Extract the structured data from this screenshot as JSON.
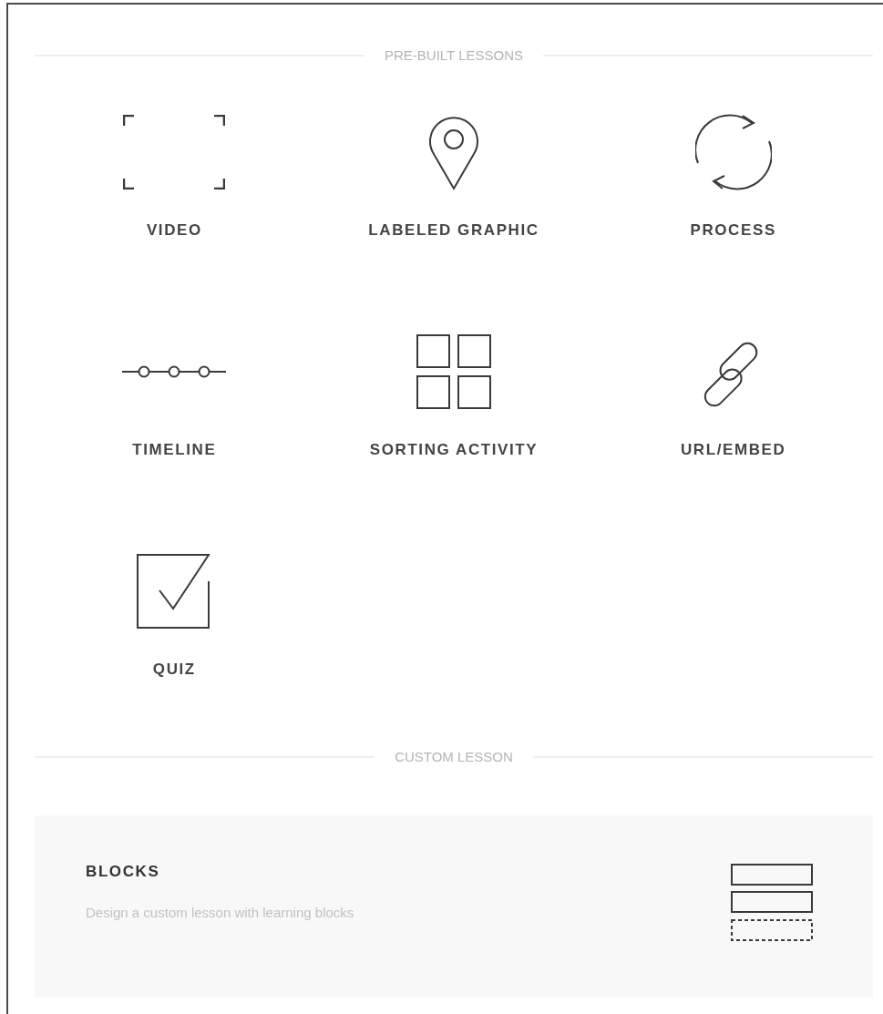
{
  "prebuilt_heading": "PRE-BUILT LESSONS",
  "lessons": [
    {
      "kind": "video",
      "label": "VIDEO"
    },
    {
      "kind": "pin",
      "label": "LABELED GRAPHIC"
    },
    {
      "kind": "process",
      "label": "PROCESS"
    },
    {
      "kind": "timeline",
      "label": "TIMELINE"
    },
    {
      "kind": "grid",
      "label": "SORTING ACTIVITY"
    },
    {
      "kind": "link",
      "label": "URL/EMBED"
    },
    {
      "kind": "quiz",
      "label": "QUIZ"
    }
  ],
  "custom_heading": "CUSTOM LESSON",
  "custom_card": {
    "title": "BLOCKS",
    "description": "Design a custom lesson with learning blocks"
  }
}
